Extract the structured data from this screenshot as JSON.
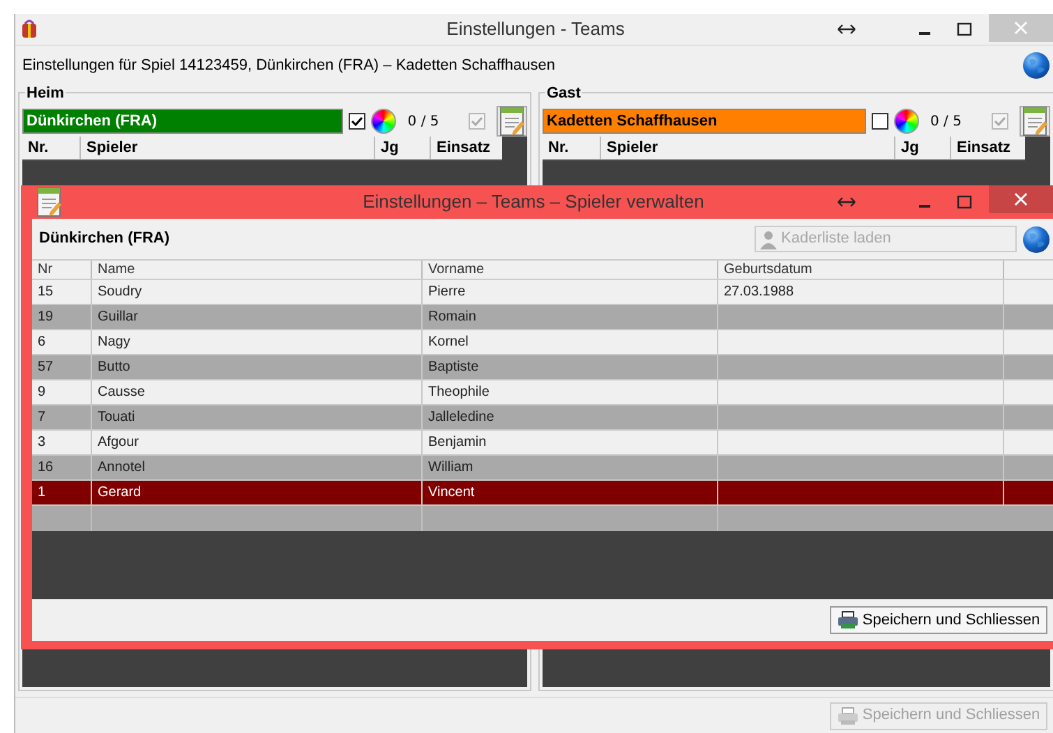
{
  "window": {
    "title": "Einstellungen - Teams",
    "subtitle": "Einstellungen für Spiel 14123459, Dünkirchen (FRA) – Kadetten Schaffhausen"
  },
  "teams": [
    {
      "legend": "Heim",
      "name": "Dünkirchen (FRA)",
      "color": "#008000",
      "checked": true,
      "count": "0 / 5",
      "locked": true,
      "columns": [
        "Nr.",
        "Spieler",
        "Jg",
        "Einsatz"
      ]
    },
    {
      "legend": "Gast",
      "name": "Kadetten Schaffhausen",
      "color": "#ff8000",
      "checked": false,
      "count": "0 / 5",
      "locked": true,
      "columns": [
        "Nr.",
        "Spieler",
        "Jg",
        "Einsatz"
      ]
    }
  ],
  "dialog": {
    "title": "Einstellungen – Teams – Spieler verwalten",
    "team": "Dünkirchen (FRA)",
    "load_button": {
      "label": "Kaderliste laden",
      "disabled": true
    },
    "columns": [
      "Nr",
      "Name",
      "Vorname",
      "Geburtsdatum"
    ],
    "rows": [
      {
        "nr": "15",
        "name": "Soudry",
        "first_name": "Pierre",
        "birthdate": "27.03.1988",
        "selected": false
      },
      {
        "nr": "19",
        "name": "Guillar",
        "first_name": "Romain",
        "selected": false
      },
      {
        "nr": "6",
        "name": "Nagy",
        "first_name": "Kornel",
        "selected": false
      },
      {
        "nr": "57",
        "name": "Butto",
        "first_name": "Baptiste",
        "selected": false
      },
      {
        "nr": "9",
        "name": "Causse",
        "first_name": "Theophile",
        "selected": false
      },
      {
        "nr": "7",
        "name": "Touati",
        "first_name": "Jalleledine",
        "selected": false
      },
      {
        "nr": "3",
        "name": "Afgour",
        "first_name": "Benjamin",
        "selected": false
      },
      {
        "nr": "16",
        "name": "Annotel",
        "first_name": "William",
        "selected": false
      },
      {
        "nr": "1",
        "name": "Gerard",
        "first_name": "Vincent",
        "selected": true
      }
    ],
    "save_button": {
      "label": "Speichern und Schliessen",
      "disabled": false
    }
  },
  "save_button": {
    "label": "Speichern und Schliessen",
    "disabled": true
  }
}
